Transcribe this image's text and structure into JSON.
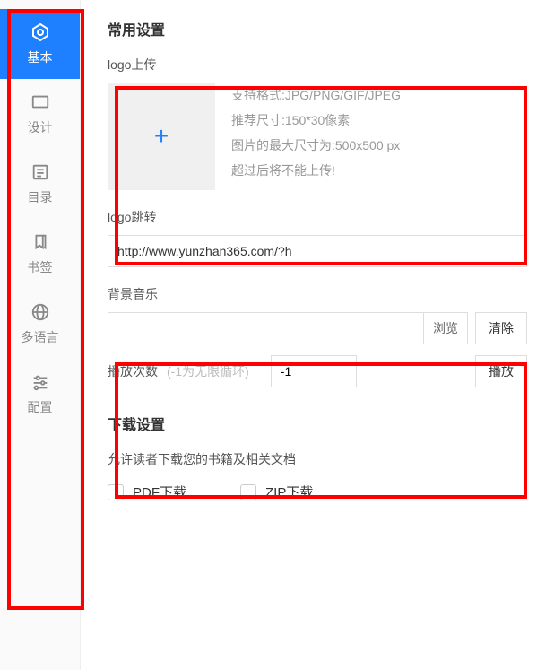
{
  "sidebar": {
    "items": [
      {
        "label": "基本",
        "icon": "hexagon"
      },
      {
        "label": "设计",
        "icon": "monitor"
      },
      {
        "label": "目录",
        "icon": "list"
      },
      {
        "label": "书签",
        "icon": "bookmark"
      },
      {
        "label": "多语言",
        "icon": "globe"
      },
      {
        "label": "配置",
        "icon": "sliders"
      }
    ]
  },
  "common": {
    "title": "常用设置",
    "logo_upload_label": "logo上传",
    "logo_desc_line1": "支持格式:JPG/PNG/GIF/JPEG",
    "logo_desc_line2": "推荐尺寸:150*30像素",
    "logo_desc_line3": "图片的最大尺寸为:500x500 px",
    "logo_desc_line4": "超过后将不能上传!",
    "logo_link_label": "logo跳转",
    "logo_link_value": "http://www.yunzhan365.com/?h",
    "bg_music_label": "背景音乐",
    "bg_music_value": "",
    "browse_btn": "浏览",
    "clear_btn": "清除",
    "play_count_label": "播放次数",
    "play_count_hint": "(-1为无限循环)",
    "play_count_value": "-1",
    "play_btn": "播放"
  },
  "download": {
    "title": "下载设置",
    "desc": "允许读者下载您的书籍及相关文档",
    "pdf_label": "PDF下载",
    "zip_label": "ZIP下载"
  }
}
